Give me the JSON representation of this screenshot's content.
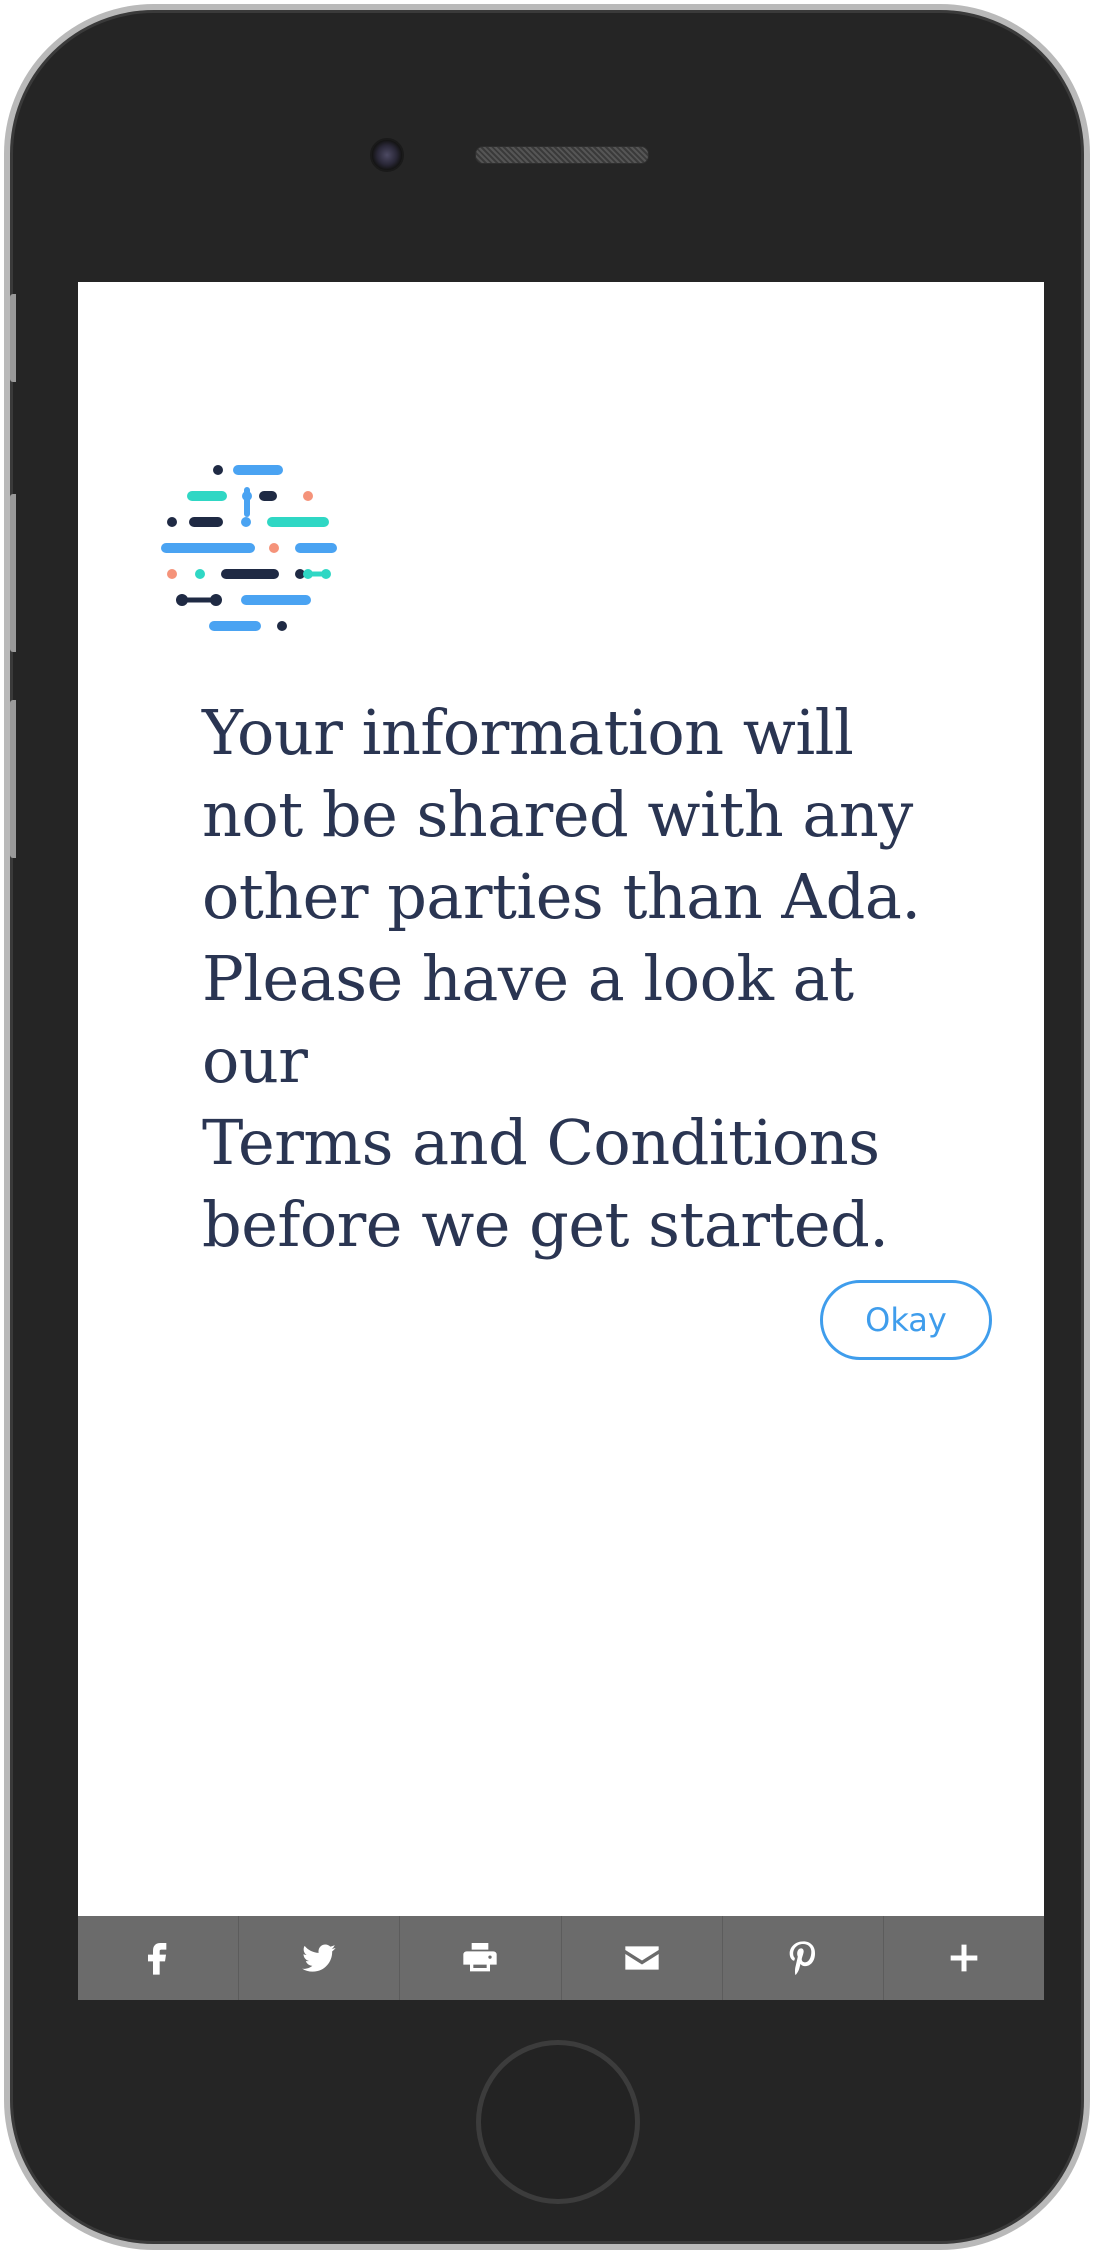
{
  "device": {
    "name": "phone-frame"
  },
  "message": {
    "lines": [
      "Your information will",
      "not be shared with any",
      "other parties than Ada.",
      "Please have a look at our",
      "Terms and Conditions",
      "before we get started."
    ]
  },
  "actions": {
    "okay_label": "Okay"
  },
  "colors": {
    "accent": "#3f9dec",
    "text": "#2a3552",
    "share_bar": "#6b6b6b",
    "logo_teal": "#2fd7c4",
    "logo_navy": "#1f2a44",
    "logo_blue": "#4aa3f2",
    "logo_salmon": "#f5937a"
  },
  "share_bar": {
    "items": [
      {
        "icon": "facebook-icon"
      },
      {
        "icon": "twitter-icon"
      },
      {
        "icon": "print-icon"
      },
      {
        "icon": "email-icon"
      },
      {
        "icon": "pinterest-icon"
      },
      {
        "icon": "plus-icon"
      }
    ]
  }
}
